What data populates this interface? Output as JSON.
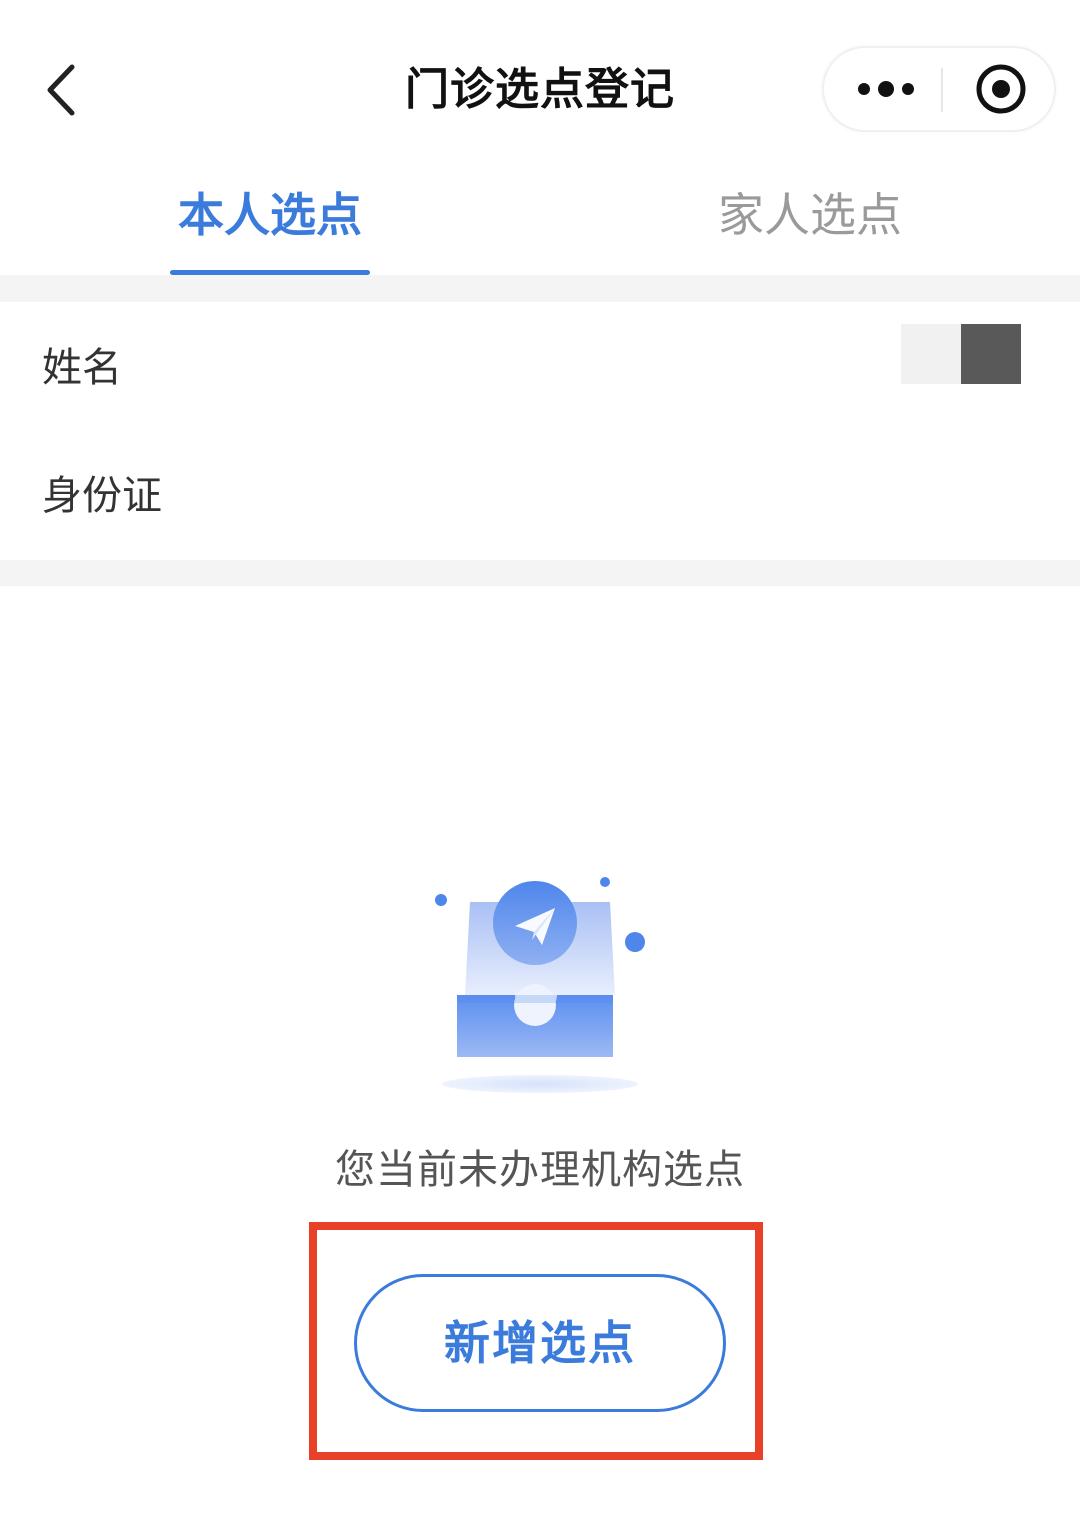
{
  "header": {
    "title": "门诊选点登记",
    "back_icon": "chevron-left-icon",
    "more_icon": "more-dots-icon",
    "close_icon": "target-circle-icon"
  },
  "tabs": [
    {
      "label": "本人选点",
      "active": true
    },
    {
      "label": "家人选点",
      "active": false
    }
  ],
  "info": {
    "name_label": "姓名",
    "id_label": "身份证"
  },
  "empty_state": {
    "illustration": "paper-plane-inbox-icon",
    "message": "您当前未办理机构选点"
  },
  "actions": {
    "add_button_label": "新增选点"
  },
  "colors": {
    "accent": "#3a7bdc",
    "inactive_tab": "#9a9a9a",
    "highlight": "#e84128"
  }
}
